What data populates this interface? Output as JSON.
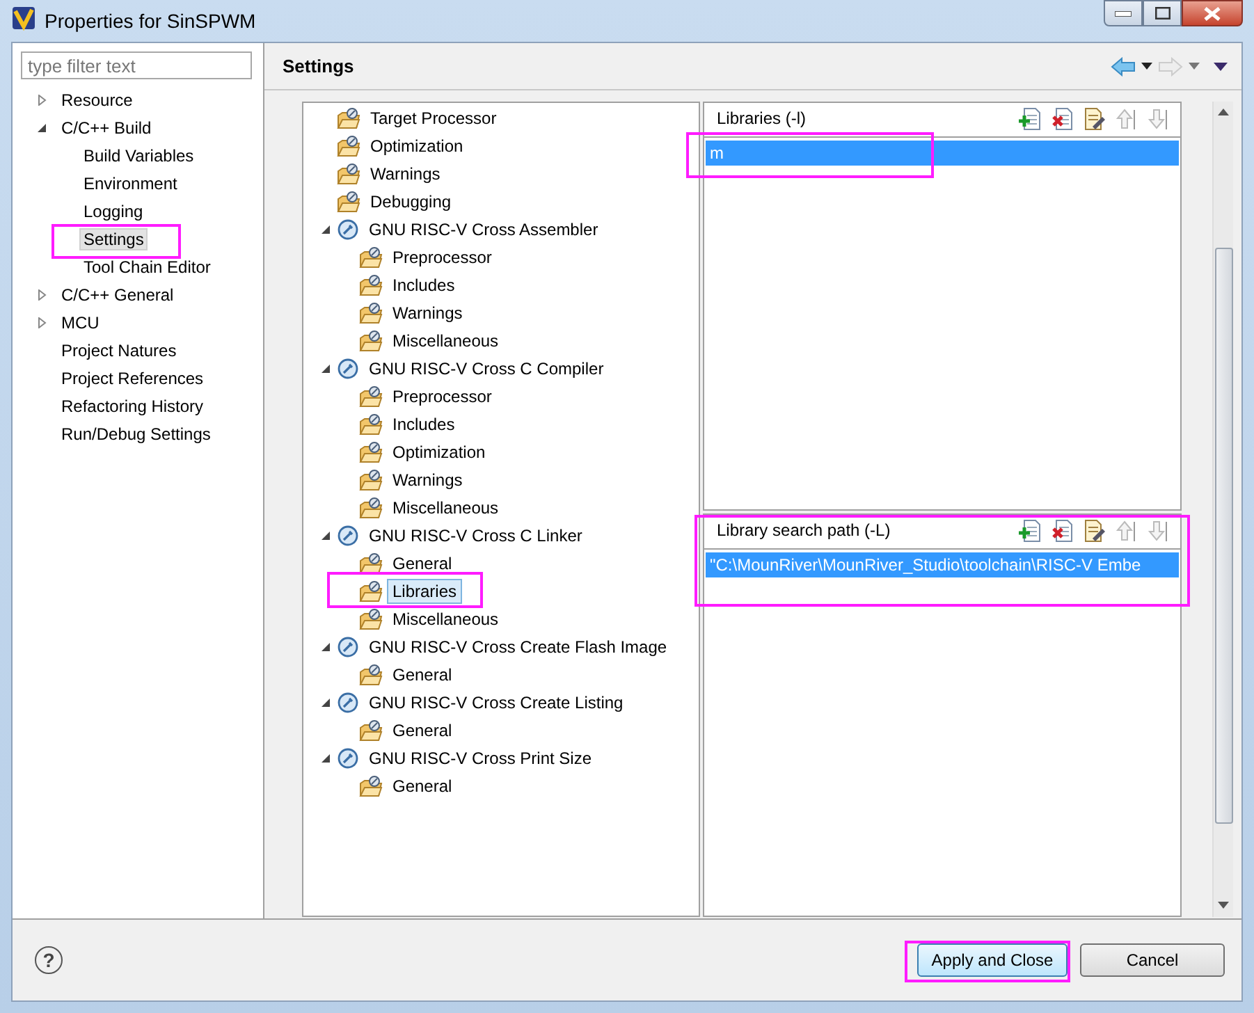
{
  "window": {
    "title": "Properties for SinSPWM"
  },
  "filter": {
    "placeholder": "type filter text"
  },
  "nav_tree": [
    {
      "label": "Resource",
      "expanded": false,
      "selected": false
    },
    {
      "label": "C/C++ Build",
      "expanded": true,
      "selected": false,
      "children": [
        {
          "label": "Build Variables",
          "selected": false
        },
        {
          "label": "Environment",
          "selected": false
        },
        {
          "label": "Logging",
          "selected": false
        },
        {
          "label": "Settings",
          "selected": true
        },
        {
          "label": "Tool Chain Editor",
          "selected": false
        }
      ]
    },
    {
      "label": "C/C++ General",
      "expanded": false,
      "selected": false
    },
    {
      "label": "MCU",
      "expanded": false,
      "selected": false
    },
    {
      "label": "Project Natures",
      "selected": false
    },
    {
      "label": "Project References",
      "selected": false
    },
    {
      "label": "Refactoring History",
      "selected": false
    },
    {
      "label": "Run/Debug Settings",
      "selected": false
    }
  ],
  "page_title": "Settings",
  "tool_tree": [
    {
      "label": "Target Processor",
      "kind": "page",
      "selected": false
    },
    {
      "label": "Optimization",
      "kind": "page",
      "selected": false
    },
    {
      "label": "Warnings",
      "kind": "page",
      "selected": false
    },
    {
      "label": "Debugging",
      "kind": "page",
      "selected": false
    },
    {
      "label": "GNU RISC-V Cross Assembler",
      "kind": "tool",
      "expanded": true,
      "selected": false,
      "children": [
        {
          "label": "Preprocessor",
          "kind": "page",
          "selected": false
        },
        {
          "label": "Includes",
          "kind": "page",
          "selected": false
        },
        {
          "label": "Warnings",
          "kind": "page",
          "selected": false
        },
        {
          "label": "Miscellaneous",
          "kind": "page",
          "selected": false
        }
      ]
    },
    {
      "label": "GNU RISC-V Cross C Compiler",
      "kind": "tool",
      "expanded": true,
      "selected": false,
      "children": [
        {
          "label": "Preprocessor",
          "kind": "page",
          "selected": false
        },
        {
          "label": "Includes",
          "kind": "page",
          "selected": false
        },
        {
          "label": "Optimization",
          "kind": "page",
          "selected": false
        },
        {
          "label": "Warnings",
          "kind": "page",
          "selected": false
        },
        {
          "label": "Miscellaneous",
          "kind": "page",
          "selected": false
        }
      ]
    },
    {
      "label": "GNU RISC-V Cross C Linker",
      "kind": "tool",
      "expanded": true,
      "selected": false,
      "children": [
        {
          "label": "General",
          "kind": "page",
          "selected": false
        },
        {
          "label": "Libraries",
          "kind": "page",
          "selected": true
        },
        {
          "label": "Miscellaneous",
          "kind": "page",
          "selected": false
        }
      ]
    },
    {
      "label": "GNU RISC-V Cross Create Flash Image",
      "kind": "tool",
      "expanded": true,
      "selected": false,
      "children": [
        {
          "label": "General",
          "kind": "page",
          "selected": false
        }
      ]
    },
    {
      "label": "GNU RISC-V Cross Create Listing",
      "kind": "tool",
      "expanded": true,
      "selected": false,
      "children": [
        {
          "label": "General",
          "kind": "page",
          "selected": false
        }
      ]
    },
    {
      "label": "GNU RISC-V Cross Print Size",
      "kind": "tool",
      "expanded": true,
      "selected": false,
      "children": [
        {
          "label": "General",
          "kind": "page",
          "selected": false
        }
      ]
    }
  ],
  "lists": [
    {
      "title": "Libraries (-l)",
      "items": [
        {
          "text": "m",
          "selected": true
        }
      ]
    },
    {
      "title": "Library search path (-L)",
      "items": [
        {
          "text": "\"C:\\MounRiver\\MounRiver_Studio\\toolchain\\RISC-V Embe",
          "selected": true
        }
      ]
    }
  ],
  "help_icon": "?",
  "buttons": [
    {
      "label": "Apply and Close",
      "kind": "default"
    },
    {
      "label": "Cancel",
      "kind": "normal"
    }
  ]
}
